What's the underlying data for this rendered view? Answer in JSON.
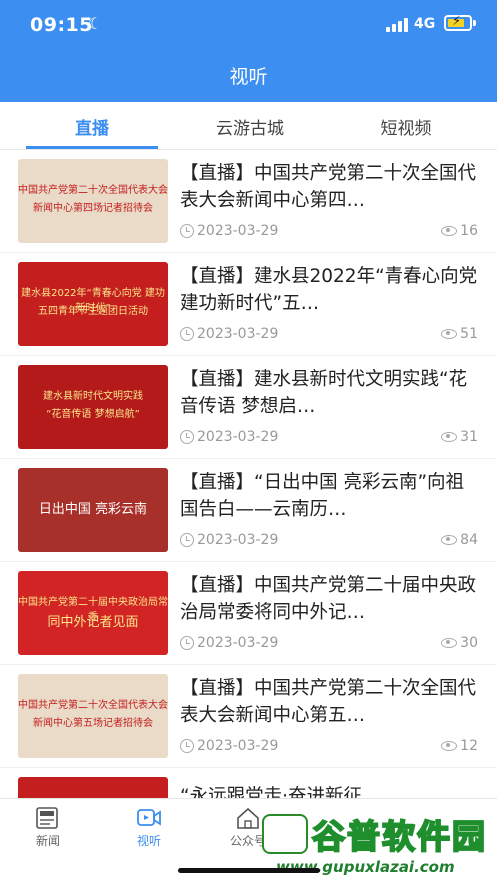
{
  "status_bar": {
    "time": "09:15",
    "network": "4G"
  },
  "header": {
    "title": "视听"
  },
  "tabs": [
    {
      "label": "直播"
    },
    {
      "label": "云游古城"
    },
    {
      "label": "短视频"
    }
  ],
  "items": [
    {
      "title": "【直播】中国共产党第二十次全国代表大会新闻中心第四…",
      "date": "2023-03-29",
      "views": "16",
      "thumb_line1": "中国共产党第二十次全国代表大会",
      "thumb_line2": "新闻中心第四场记者招待会"
    },
    {
      "title": "【直播】建水县2022年“青春心向党 建功新时代”五…",
      "date": "2023-03-29",
      "views": "51",
      "thumb_line1": "建水县2022年“青春心向党 建功新时代”",
      "thumb_line2": "五四青年节主题团日活动"
    },
    {
      "title": "【直播】建水县新时代文明实践“花音传语 梦想启…",
      "date": "2023-03-29",
      "views": "31",
      "thumb_line1": "建水县新时代文明实践",
      "thumb_line2": "“花音传语 梦想启航”"
    },
    {
      "title": "【直播】“日出中国 亮彩云南”向祖国告白——云南历…",
      "date": "2023-03-29",
      "views": "84",
      "thumb_line1": "日出中国 亮彩云南",
      "thumb_line2": ""
    },
    {
      "title": "【直播】中国共产党第二十届中央政治局常委将同中外记…",
      "date": "2023-03-29",
      "views": "30",
      "thumb_line1": "中国共产党第二十届中央政治局常委",
      "thumb_line2": "同中外记者见面"
    },
    {
      "title": "【直播】中国共产党第二十次全国代表大会新闻中心第五…",
      "date": "2023-03-29",
      "views": "12",
      "thumb_line1": "中国共产党第二十次全国代表大会",
      "thumb_line2": "新闻中心第五场记者招待会"
    }
  ],
  "partial_item_title": "“永远跟党走·奋进新征",
  "nav": [
    {
      "label": "新闻"
    },
    {
      "label": "视听"
    },
    {
      "label": "公众号"
    }
  ],
  "watermark": {
    "text": "谷普软件园",
    "url": "www.gupuxlazai.com"
  },
  "colors": {
    "primary": "#3c8ef0",
    "thumb_red": "#c41e1e"
  }
}
